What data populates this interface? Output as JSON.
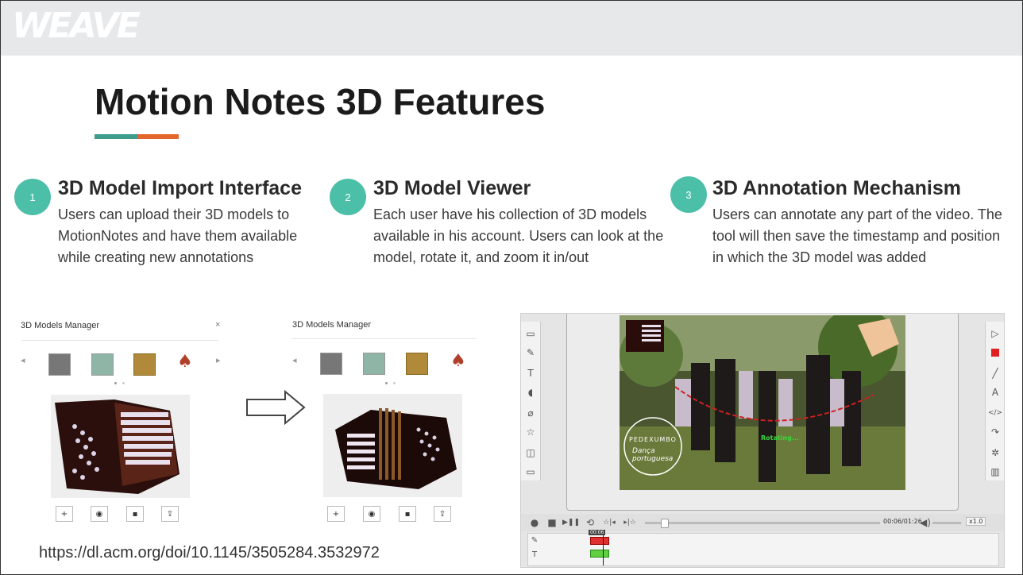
{
  "header": {
    "logo_text": "WEAVE"
  },
  "slide": {
    "title": "Motion Notes 3D Features"
  },
  "features": [
    {
      "number": "1",
      "heading": "3D Model Import Interface",
      "description": "Users can upload their 3D models to MotionNotes and have them available while creating new annotations"
    },
    {
      "number": "2",
      "heading": "3D Model Viewer",
      "description": "Each user have his collection of 3D models available in his account. Users can look at the model, rotate it, and zoom it in/out"
    },
    {
      "number": "3",
      "heading": "3D Annotation Mechanism",
      "description": "Users can annotate any part of the video. The tool will then save the timestamp and position in which the 3D model was added"
    }
  ],
  "manager_left": {
    "title": "3D Models Manager",
    "close": "×"
  },
  "manager_right": {
    "title": "3D Models Manager"
  },
  "video": {
    "overlay_label": "Rotating...",
    "watermark_line1": "PEDEXUMBO",
    "watermark_line2": "Dança portuguesa",
    "time": "00:06/01:26",
    "speed": "x1.0",
    "marker_time": "00:06"
  },
  "footer": {
    "url": "https://dl.acm.org/doi/10.1145/3505284.3532972"
  },
  "colors": {
    "teal": "#3e9c8c",
    "orange": "#e3672c",
    "badge": "#4cbfa8"
  }
}
